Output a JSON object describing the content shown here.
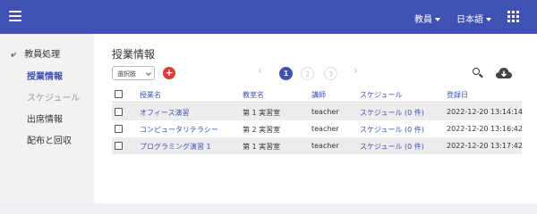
{
  "appbar": {
    "role_menu": "教員",
    "language_menu": "日本語"
  },
  "sidebar": {
    "back_label": "教員処理",
    "items": [
      {
        "label": "授業情報",
        "state": "active"
      },
      {
        "label": "スケジュール",
        "state": "disabled"
      },
      {
        "label": "出席情報",
        "state": "normal"
      },
      {
        "label": "配布と回収",
        "state": "normal"
      }
    ]
  },
  "main": {
    "title": "授業情報",
    "select_value": "選択肢",
    "add_label": "+",
    "pagination": {
      "prev": "‹",
      "next": "›",
      "pages": [
        "1",
        "2",
        "3"
      ],
      "current": "1"
    },
    "table": {
      "headers": [
        "授業名",
        "教室名",
        "講師",
        "スケジュール",
        "登録日"
      ],
      "rows": [
        {
          "course": "オフィース演習",
          "room": "第 1 実習室",
          "teacher": "teacher",
          "schedule": "スケジュール (0 件)",
          "date": "2022-12-20 13:14:14"
        },
        {
          "course": "コンピュータリテラシー",
          "room": "第 2 実習室",
          "teacher": "teacher",
          "schedule": "スケジュール (0 件)",
          "date": "2022-12-20 13:16:42"
        },
        {
          "course": "プログラミング演習 1",
          "room": "第 1 実習室",
          "teacher": "teacher",
          "schedule": "スケジュール (0 件)",
          "date": "2022-12-20 13:17:42"
        }
      ]
    }
  },
  "colors": {
    "primary": "#3f51b5",
    "add_button": "#e53935",
    "sidebar_bg": "#f2f2f2",
    "page_bg": "#eef0f6"
  },
  "icons": {
    "menu": "hamburger-menu-icon",
    "apps": "apps-grid-icon",
    "back": "back-arrow-icon",
    "search": "search-icon",
    "download": "cloud-download-icon"
  }
}
